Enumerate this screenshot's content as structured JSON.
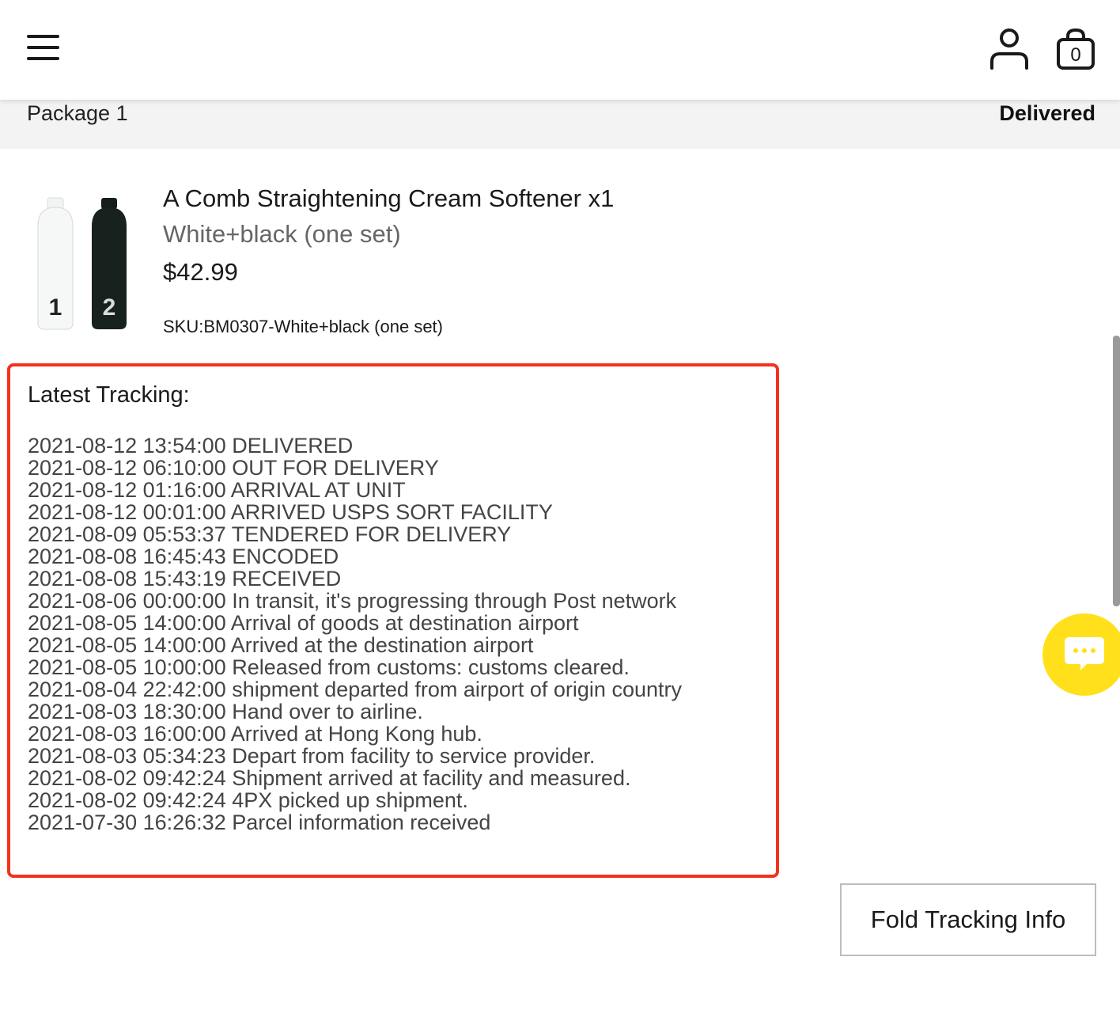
{
  "header": {
    "menu_icon": "hamburger-menu-icon",
    "account_icon": "user-icon",
    "cart_icon": "shopping-bag-icon",
    "cart_count": "0"
  },
  "package": {
    "title": "Package 1",
    "status": "Delivered"
  },
  "product": {
    "image_icon": "product-bottles",
    "name": "A Comb Straightening Cream Softener x1",
    "variant": "White+black (one set)",
    "price": "$42.99",
    "sku": "SKU:BM0307-White+black (one set)"
  },
  "tracking": {
    "title": "Latest Tracking:",
    "accent_color": "#f4311e",
    "events": [
      "2021-08-12 13:54:00 DELIVERED",
      "2021-08-12 06:10:00 OUT FOR DELIVERY",
      "2021-08-12 01:16:00 ARRIVAL AT UNIT",
      "2021-08-12 00:01:00 ARRIVED USPS SORT FACILITY",
      "2021-08-09 05:53:37 TENDERED FOR DELIVERY",
      "2021-08-08 16:45:43 ENCODED",
      "2021-08-08 15:43:19 RECEIVED",
      "2021-08-06 00:00:00 In transit, it's progressing through Post network",
      "2021-08-05 14:00:00 Arrival of goods at destination airport",
      "2021-08-05 14:00:00 Arrived at the destination airport",
      "2021-08-05 10:00:00 Released from customs: customs cleared.",
      "2021-08-04 22:42:00 shipment departed from airport of origin country",
      "2021-08-03 18:30:00 Hand over to airline.",
      "2021-08-03 16:00:00 Arrived at Hong Kong hub.",
      "2021-08-03 05:34:23 Depart from facility to service provider.",
      "2021-08-02 09:42:24 Shipment arrived at facility and measured.",
      "2021-08-02 09:42:24 4PX picked up shipment.",
      "2021-07-30 16:26:32 Parcel information received"
    ]
  },
  "chat": {
    "icon": "chat-icon",
    "color": "#ffe01b"
  },
  "fold_button": {
    "label": "Fold Tracking Info"
  }
}
